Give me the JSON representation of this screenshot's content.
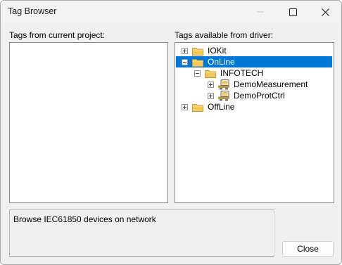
{
  "window": {
    "title": "Tag Browser"
  },
  "left_panel": {
    "label": "Tags from current project:",
    "items": []
  },
  "right_panel": {
    "label": "Tags available from driver:",
    "tree": [
      {
        "label": "IOKit",
        "expander": "plus",
        "icon": "folder-icon",
        "selected": false
      },
      {
        "label": "OnLine",
        "expander": "minus",
        "icon": "folder-icon",
        "selected": true
      },
      {
        "label": "INFOTECH",
        "expander": "minus",
        "icon": "folder-icon",
        "selected": false
      },
      {
        "label": "DemoMeasurement",
        "expander": "plus",
        "icon": "device-icon",
        "selected": false
      },
      {
        "label": "DemoProtCtrl",
        "expander": "plus",
        "icon": "device-icon",
        "selected": false
      },
      {
        "label": "OffLine",
        "expander": "plus",
        "icon": "folder-icon",
        "selected": false
      }
    ]
  },
  "status": {
    "text": "Browse IEC61850 devices on network"
  },
  "buttons": {
    "close_label": "Close"
  },
  "colors": {
    "selection": "#0078d7",
    "folder": "#f5c85a",
    "window_bg": "#f0f0f0"
  }
}
